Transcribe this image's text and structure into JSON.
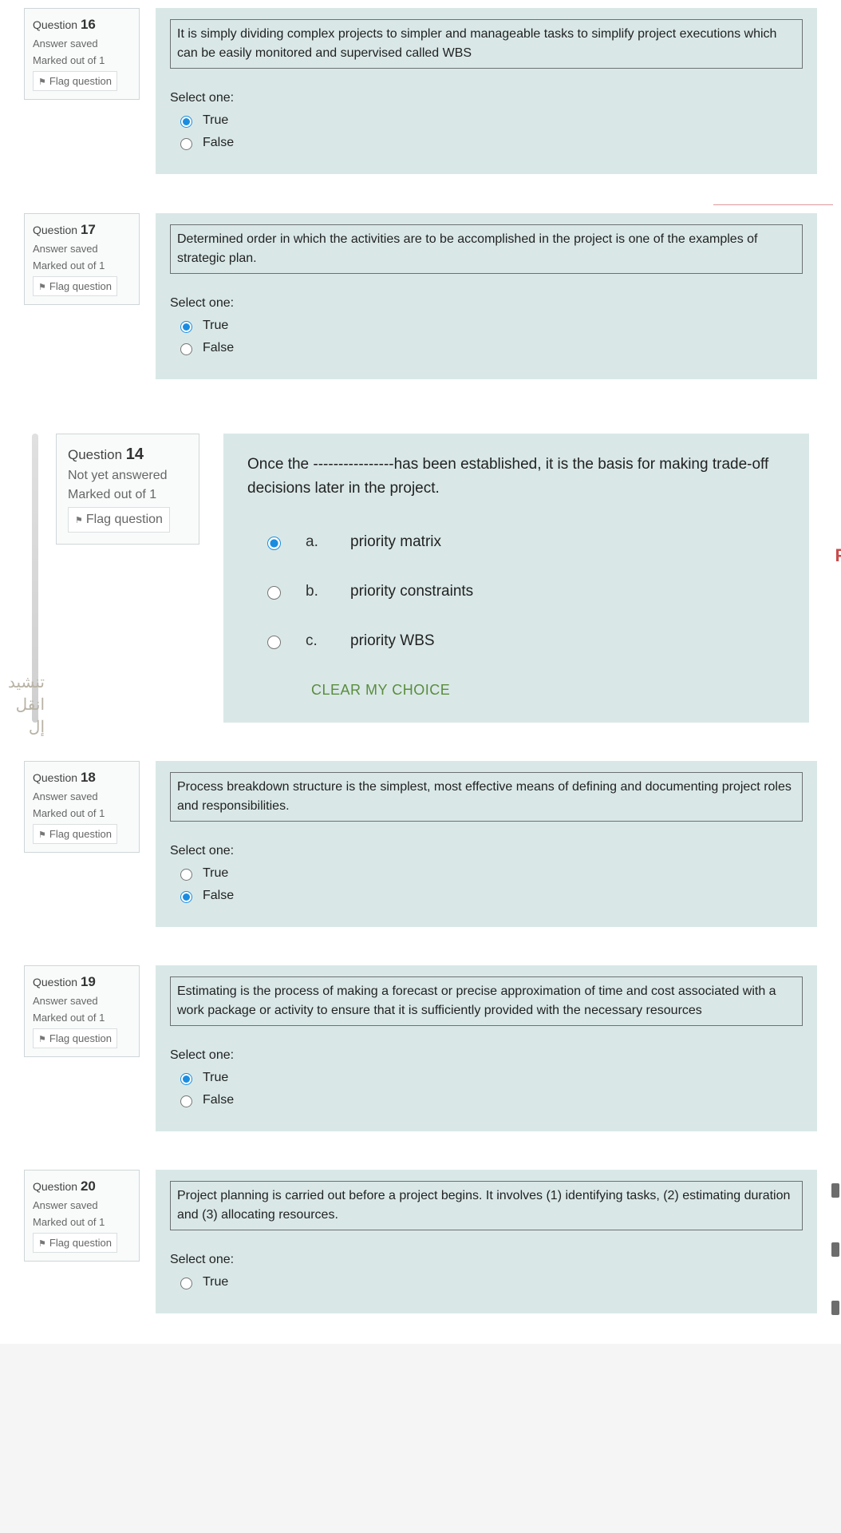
{
  "labels": {
    "question_word": "Question",
    "answer_saved": "Answer saved",
    "not_yet": "Not yet answered",
    "marked_out_of_1": "Marked out of 1",
    "flag": "Flag question",
    "select_one": "Select one:",
    "true": "True",
    "false": "False",
    "clear_choice": "CLEAR MY CHOICE"
  },
  "side_note": "تنشيد\nانقل إل",
  "big_right_peek": "F",
  "questions": [
    {
      "id": "q16",
      "number": "16",
      "state_key": "answer_saved",
      "stem": "It is simply dividing complex projects to simpler and manageable tasks to simplify project executions which can be easily monitored and supervised called WBS",
      "type": "tf",
      "selected": "true"
    },
    {
      "id": "q17",
      "number": "17",
      "state_key": "answer_saved",
      "stem": "Determined order in which the activities are to be accomplished in the project is one of the examples of strategic plan.",
      "type": "tf",
      "selected": "true"
    },
    {
      "id": "q14",
      "number": "14",
      "state_key": "not_yet",
      "stem": "Once the ----------------has been established, it is the basis for making trade-off decisions later in the project.",
      "type": "mc",
      "options": [
        {
          "letter": "a.",
          "text": "priority matrix"
        },
        {
          "letter": "b.",
          "text": "priority constraints"
        },
        {
          "letter": "c.",
          "text": "priority WBS"
        }
      ],
      "selected": "a."
    },
    {
      "id": "q18",
      "number": "18",
      "state_key": "answer_saved",
      "stem": "Process breakdown structure is the simplest, most effective means of defining and documenting project roles and responsibilities.",
      "type": "tf",
      "selected": "false"
    },
    {
      "id": "q19",
      "number": "19",
      "state_key": "answer_saved",
      "stem": "Estimating is the process of making a forecast or precise approximation of time and cost associated with a work package or activity to ensure that it is sufficiently provided with the necessary resources",
      "type": "tf",
      "selected": "true"
    },
    {
      "id": "q20",
      "number": "20",
      "state_key": "answer_saved",
      "stem": "Project planning is carried out before a project begins. It involves (1) identifying tasks, (2) estimating duration and (3) allocating resources.",
      "type": "tf",
      "selected": null,
      "truncated": true
    }
  ]
}
